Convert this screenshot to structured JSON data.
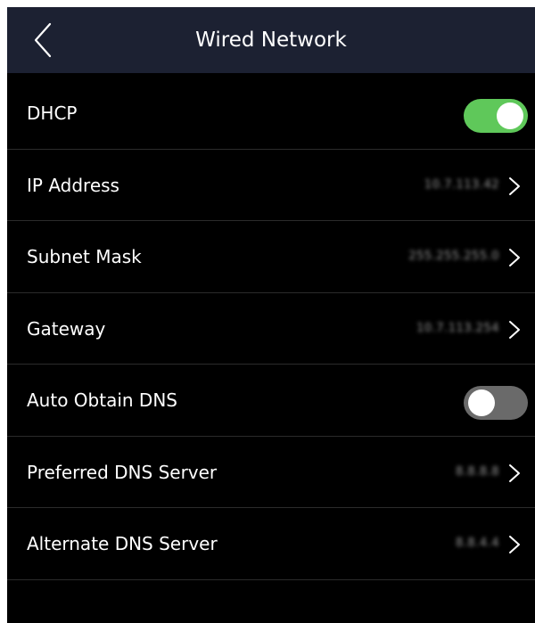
{
  "header": {
    "title": "Wired Network",
    "back_icon": "chevron-left-icon"
  },
  "colors": {
    "header_bg": "#1c2132",
    "toggle_on": "#5fc85a",
    "toggle_off": "#6a6a6a",
    "background": "#000000"
  },
  "settings": {
    "dhcp": {
      "label": "DHCP",
      "enabled": true
    },
    "ip_address": {
      "label": "IP Address",
      "value": "10.7.113.42"
    },
    "subnet_mask": {
      "label": "Subnet Mask",
      "value": "255.255.255.0"
    },
    "gateway": {
      "label": "Gateway",
      "value": "10.7.113.254"
    },
    "auto_dns": {
      "label": "Auto Obtain DNS",
      "enabled": false
    },
    "preferred_dns": {
      "label": "Preferred DNS Server",
      "value": "8.8.8.8"
    },
    "alternate_dns": {
      "label": "Alternate DNS Server",
      "value": "8.8.4.4"
    }
  }
}
